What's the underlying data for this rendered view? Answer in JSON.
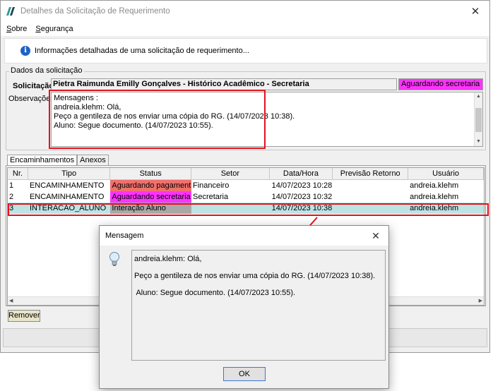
{
  "window": {
    "title": "Detalhes da Solicitação de Requerimento",
    "close_glyph": "✕"
  },
  "menu": {
    "items": [
      "Sobre",
      "Segurança"
    ]
  },
  "info": {
    "text": "Informações detalhadas de uma solicitação de requerimento..."
  },
  "solicitacao": {
    "group_title": "Dados da solicitação",
    "label": "Solicitação:",
    "value": "Pietra Raimunda Emilly Gonçalves - Histórico Acadêmico - Secretaria",
    "status": "Aguardando secretaria",
    "status_color": "#ff33ff",
    "obs_label": "Observações:",
    "obs_lines": [
      "Mensagens :",
      "",
      "andreia.klehm: Olá,",
      "",
      "Peço a gentileza de nos enviar uma cópia do RG. (14/07/2023 10:38).",
      "Aluno: Segue documento. (14/07/2023 10:55)."
    ]
  },
  "tabs": [
    "Encaminhamentos",
    "Anexos"
  ],
  "grid": {
    "columns": [
      "Nr.",
      "Tipo",
      "Status",
      "Setor",
      "Data/Hora",
      "Previsão Retorno",
      "Usuário"
    ],
    "rows": [
      {
        "nr": "1",
        "tipo": "ENCAMINHAMENTO",
        "status": "Aguardando pagamento",
        "status_color": "#f0706c",
        "setor": "Financeiro",
        "data": "14/07/2023 10:28",
        "previsao": "",
        "usuario": "andreia.klehm"
      },
      {
        "nr": "2",
        "tipo": "ENCAMINHAMENTO",
        "status": "Aguardando secretaria",
        "status_color": "#ff33ff",
        "setor": "Secretaria",
        "data": "14/07/2023 10:32",
        "previsao": "",
        "usuario": "andreia.klehm"
      },
      {
        "nr": "3",
        "tipo": "INTERACAO_ALUNO",
        "status": "Interação Aluno",
        "status_color": "#a8a8a8",
        "setor": "",
        "data": "14/07/2023 10:38",
        "previsao": "",
        "usuario": "andreia.klehm"
      }
    ]
  },
  "buttons": {
    "remover": "Remover"
  },
  "dialog": {
    "title": "Mensagem",
    "close_glyph": "✕",
    "lines": [
      "andreia.klehm: Olá,",
      "Peço a gentileza de nos enviar uma cópia do RG. (14/07/2023 10:38).",
      " Aluno: Segue documento. (14/07/2023 10:55)."
    ],
    "ok": "OK",
    "icon": "lightbulb-icon"
  },
  "colors": {
    "highlight": "#e0141e",
    "selected_row": "#bde4e4"
  }
}
